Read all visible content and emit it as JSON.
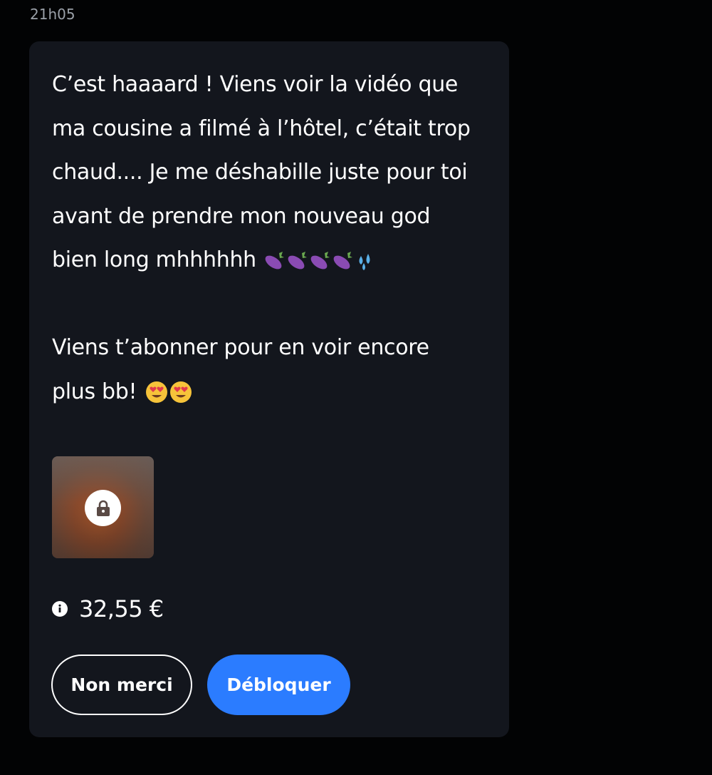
{
  "timestamp": "21h05",
  "message": {
    "line1": "C’est haaaard ! Viens voir la vidéo que",
    "line2": "ma cousine a filmé à l’hôtel, c’était trop",
    "line3": "chaud.... Je me déshabille juste pour toi",
    "line4": "avant de prendre mon nouveau god",
    "line5": "bien long mhhhhhh",
    "line6": "Viens t’abonner pour en voir encore",
    "line7": "plus bb!"
  },
  "media": {
    "locked": true,
    "icon": "lock-icon"
  },
  "price": {
    "icon": "info-icon",
    "value": "32,55 €"
  },
  "buttons": {
    "decline_label": "Non merci",
    "unlock_label": "Débloquer"
  },
  "colors": {
    "background": "#020304",
    "bubble": "#13161d",
    "accent": "#2b7cff",
    "timestamp": "#9aa0a8"
  }
}
